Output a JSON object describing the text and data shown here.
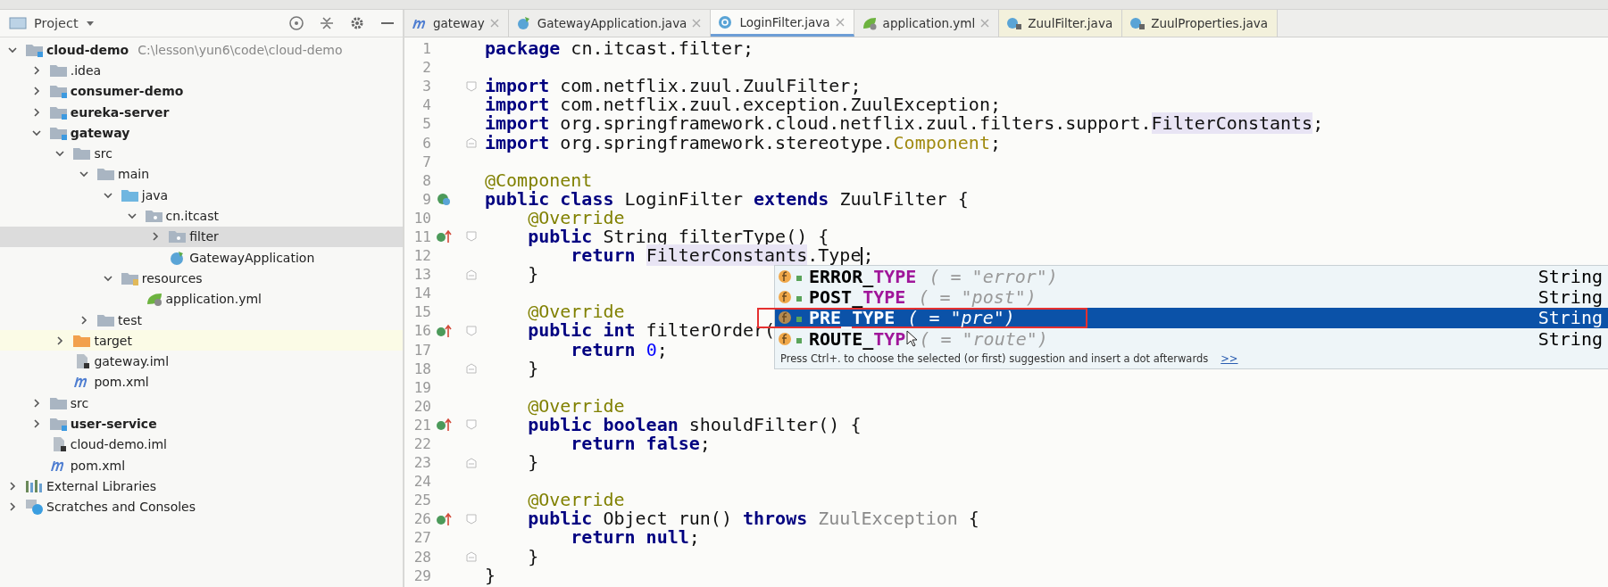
{
  "project_panel": {
    "title": "Project",
    "tree": [
      {
        "label": "cloud-demo",
        "path": "C:\\lesson\\yun6\\code\\cloud-demo",
        "kind": "module",
        "bold": true,
        "expanded": true,
        "selected": false,
        "children": [
          {
            "label": ".idea",
            "kind": "folder",
            "bold": false,
            "expanded": false,
            "selected": false
          },
          {
            "label": "consumer-demo",
            "kind": "module",
            "bold": true,
            "expanded": false,
            "selected": false
          },
          {
            "label": "eureka-server",
            "kind": "module",
            "bold": true,
            "expanded": false,
            "selected": false
          },
          {
            "label": "gateway",
            "kind": "module",
            "bold": true,
            "expanded": true,
            "selected": false,
            "children": [
              {
                "label": "src",
                "kind": "folder",
                "bold": false,
                "expanded": true,
                "selected": false,
                "children": [
                  {
                    "label": "main",
                    "kind": "folder",
                    "bold": false,
                    "expanded": true,
                    "selected": false,
                    "children": [
                      {
                        "label": "java",
                        "kind": "source-folder",
                        "bold": false,
                        "expanded": true,
                        "selected": false,
                        "children": [
                          {
                            "label": "cn.itcast",
                            "kind": "package",
                            "bold": false,
                            "expanded": true,
                            "selected": false,
                            "children": [
                              {
                                "label": "filter",
                                "kind": "package",
                                "bold": false,
                                "expanded": false,
                                "selected": true
                              },
                              {
                                "label": "GatewayApplication",
                                "kind": "spring-class",
                                "bold": false,
                                "selected": false
                              }
                            ]
                          }
                        ]
                      },
                      {
                        "label": "resources",
                        "kind": "resources",
                        "bold": false,
                        "expanded": true,
                        "selected": false,
                        "children": [
                          {
                            "label": "application.yml",
                            "kind": "yml",
                            "bold": false,
                            "selected": false
                          }
                        ]
                      }
                    ]
                  },
                  {
                    "label": "test",
                    "kind": "folder",
                    "bold": false,
                    "expanded": false,
                    "selected": false
                  }
                ]
              },
              {
                "label": "target",
                "kind": "excluded",
                "bold": false,
                "expanded": false,
                "selected": false
              },
              {
                "label": "gateway.iml",
                "kind": "iml",
                "bold": false,
                "selected": false
              },
              {
                "label": "pom.xml",
                "kind": "maven",
                "bold": false,
                "selected": false
              }
            ]
          },
          {
            "label": "src",
            "kind": "folder",
            "bold": false,
            "expanded": false,
            "selected": false
          },
          {
            "label": "user-service",
            "kind": "module",
            "bold": true,
            "expanded": false,
            "selected": false
          },
          {
            "label": "cloud-demo.iml",
            "kind": "iml",
            "bold": false,
            "selected": false
          },
          {
            "label": "pom.xml",
            "kind": "maven",
            "bold": false,
            "selected": false
          }
        ]
      },
      {
        "label": "External Libraries",
        "kind": "libraries",
        "bold": false,
        "expanded": false,
        "selected": false
      },
      {
        "label": "Scratches and Consoles",
        "kind": "scratches",
        "bold": false,
        "expanded": false,
        "selected": false
      }
    ]
  },
  "tabs": [
    {
      "label": "gateway",
      "kind": "maven",
      "closable": true,
      "selected": false
    },
    {
      "label": "GatewayApplication.java",
      "kind": "spring-class",
      "closable": true,
      "selected": false
    },
    {
      "label": "LoginFilter.java",
      "kind": "class",
      "closable": true,
      "selected": true
    },
    {
      "label": "application.yml",
      "kind": "yml",
      "closable": true,
      "selected": false
    },
    {
      "label": "ZuulFilter.java",
      "kind": "library-class",
      "closable": false,
      "selected": false
    },
    {
      "label": "ZuulProperties.java",
      "kind": "library-class",
      "closable": false,
      "selected": false
    }
  ],
  "editor": {
    "lines": [
      {
        "number": "1",
        "tokens": [
          {
            "kind": "kw",
            "text": "package"
          },
          {
            "kind": "plain",
            "text": " cn.itcast.filter;"
          }
        ]
      },
      {
        "number": "2"
      },
      {
        "number": "3",
        "fold": {
          "kind": "start"
        },
        "tokens": [
          {
            "kind": "kw",
            "text": "import"
          },
          {
            "kind": "plain",
            "text": " com.netflix.zuul.ZuulFilter;"
          }
        ]
      },
      {
        "number": "4",
        "tokens": [
          {
            "kind": "kw",
            "text": "import"
          },
          {
            "kind": "plain",
            "text": " com.netflix.zuul.exception.ZuulException;"
          }
        ]
      },
      {
        "number": "5",
        "tokens": [
          {
            "kind": "kw",
            "text": "import"
          },
          {
            "kind": "plain",
            "text": " org.springframework.cloud.netflix.zuul.filters.support."
          },
          {
            "kind": "ref",
            "text": "FilterConstants"
          },
          {
            "kind": "plain",
            "text": ";"
          }
        ]
      },
      {
        "number": "6",
        "fold": {
          "kind": "end"
        },
        "tokens": [
          {
            "kind": "kw",
            "text": "import"
          },
          {
            "kind": "plain",
            "text": " org.springframework.stereotype."
          },
          {
            "kind": "unused",
            "text": "Component"
          },
          {
            "kind": "plain",
            "text": ";"
          }
        ]
      },
      {
        "number": "7"
      },
      {
        "number": "8",
        "tokens": [
          {
            "kind": "annotation",
            "text": "@Component"
          }
        ]
      },
      {
        "number": "9",
        "marker": {
          "kind": "bean"
        },
        "tokens": [
          {
            "kind": "kw",
            "text": "public class"
          },
          {
            "kind": "plain",
            "text": " LoginFilter "
          },
          {
            "kind": "kw",
            "text": "extends"
          },
          {
            "kind": "plain",
            "text": " ZuulFilter {"
          }
        ]
      },
      {
        "number": "10",
        "tokens": [
          {
            "kind": "annotation",
            "text": "    @Override"
          }
        ]
      },
      {
        "number": "11",
        "marker": {
          "kind": "override"
        },
        "fold": {
          "kind": "start"
        },
        "tokens": [
          {
            "kind": "kw",
            "text": "    public"
          },
          {
            "kind": "plain",
            "text": " String filterType() {"
          }
        ]
      },
      {
        "number": "12",
        "tokens": [
          {
            "kind": "kw",
            "text": "        return "
          },
          {
            "kind": "ref",
            "text": "FilterConstants"
          },
          {
            "kind": "plain",
            "text": ".Type",
            "caret": true
          },
          {
            "kind": "plain",
            "text": ";"
          }
        ]
      },
      {
        "number": "13",
        "fold": {
          "kind": "end"
        },
        "tokens": [
          {
            "kind": "plain",
            "text": "    }"
          }
        ]
      },
      {
        "number": "14"
      },
      {
        "number": "15",
        "tokens": [
          {
            "kind": "annotation",
            "text": "    @Override"
          }
        ]
      },
      {
        "number": "16",
        "marker": {
          "kind": "override"
        },
        "fold": {
          "kind": "start"
        },
        "tokens": [
          {
            "kind": "kw",
            "text": "    public int"
          },
          {
            "kind": "plain",
            "text": " filterOrder("
          }
        ]
      },
      {
        "number": "17",
        "tokens": [
          {
            "kind": "kw",
            "text": "        return "
          },
          {
            "kind": "num",
            "text": "0"
          },
          {
            "kind": "plain",
            "text": ";"
          }
        ]
      },
      {
        "number": "18",
        "fold": {
          "kind": "end"
        },
        "tokens": [
          {
            "kind": "plain",
            "text": "    }"
          }
        ]
      },
      {
        "number": "19"
      },
      {
        "number": "20",
        "tokens": [
          {
            "kind": "annotation",
            "text": "    @Override"
          }
        ]
      },
      {
        "number": "21",
        "marker": {
          "kind": "override"
        },
        "fold": {
          "kind": "start"
        },
        "tokens": [
          {
            "kind": "kw",
            "text": "    public boolean"
          },
          {
            "kind": "plain",
            "text": " shouldFilter() {"
          }
        ]
      },
      {
        "number": "22",
        "tokens": [
          {
            "kind": "kw",
            "text": "        return false"
          },
          {
            "kind": "plain",
            "text": ";"
          }
        ]
      },
      {
        "number": "23",
        "fold": {
          "kind": "end"
        },
        "tokens": [
          {
            "kind": "plain",
            "text": "    }"
          }
        ]
      },
      {
        "number": "24"
      },
      {
        "number": "25",
        "tokens": [
          {
            "kind": "annotation",
            "text": "    @Override"
          }
        ]
      },
      {
        "number": "26",
        "marker": {
          "kind": "override"
        },
        "fold": {
          "kind": "start"
        },
        "tokens": [
          {
            "kind": "kw",
            "text": "    public"
          },
          {
            "kind": "plain",
            "text": " Object run() "
          },
          {
            "kind": "kw",
            "text": "throws"
          },
          {
            "kind": "dim",
            "text": " ZuulException"
          },
          {
            "kind": "plain",
            "text": " {"
          }
        ]
      },
      {
        "number": "27",
        "tokens": [
          {
            "kind": "kw",
            "text": "        return null"
          },
          {
            "kind": "plain",
            "text": ";"
          }
        ]
      },
      {
        "number": "28",
        "fold": {
          "kind": "end"
        },
        "tokens": [
          {
            "kind": "plain",
            "text": "    }"
          }
        ]
      },
      {
        "number": "29",
        "tokens": [
          {
            "kind": "plain",
            "text": "}"
          }
        ]
      }
    ],
    "completion": {
      "items": [
        {
          "prefix": "ERROR_",
          "match": "TYPE",
          "value": "( = \"error\")",
          "type": "String",
          "selected": false
        },
        {
          "prefix": "POST_",
          "match": "TYPE",
          "value": "( = \"post\")",
          "type": "String",
          "selected": false
        },
        {
          "prefix": "PRE_",
          "match": "TYPE",
          "value": "( = \"pre\")",
          "type": "String",
          "selected": true,
          "highlight": true
        },
        {
          "prefix": "ROUTE_",
          "match": "TYP",
          "value": "( = \"route\")",
          "type": "String",
          "selected": false,
          "pointer": true
        }
      ],
      "hint": "Press Ctrl+. to choose the selected (or first) suggestion and insert a dot afterwards",
      "hint_link": ">>"
    }
  }
}
